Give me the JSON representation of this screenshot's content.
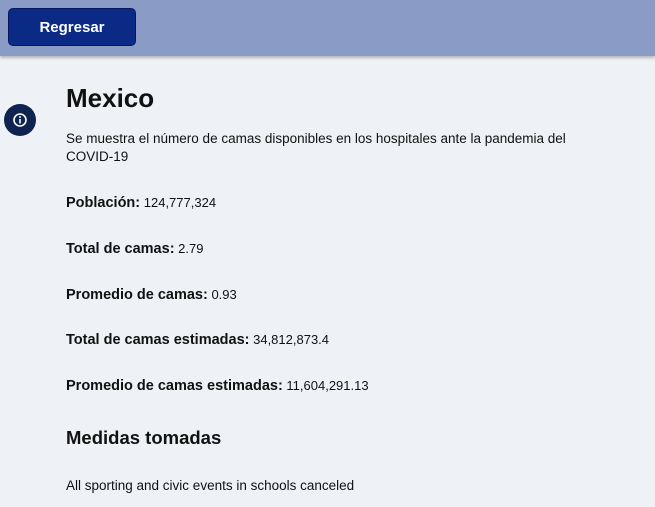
{
  "header": {
    "back_label": "Regresar"
  },
  "country": {
    "name": "Mexico",
    "description": "Se muestra el número de camas disponibles en los hospitales ante la pandemia del COVID-19"
  },
  "stats": [
    {
      "label": "Población:",
      "value": "124,777,324"
    },
    {
      "label": "Total de camas:",
      "value": "2.79"
    },
    {
      "label": "Promedio de camas:",
      "value": "0.93"
    },
    {
      "label": "Total de camas estimadas:",
      "value": "34,812,873.4"
    },
    {
      "label": "Promedio de camas estimadas:",
      "value": "11,604,291.13"
    }
  ],
  "measures": {
    "title": "Medidas tomadas",
    "items": [
      "All sporting and civic events in schools canceled"
    ]
  },
  "colors": {
    "topbar": "#8a9bc6",
    "button": "#0b2a86",
    "info_button": "#0f2351",
    "background": "#eef2f7"
  },
  "icons": {
    "info": "info-icon"
  }
}
